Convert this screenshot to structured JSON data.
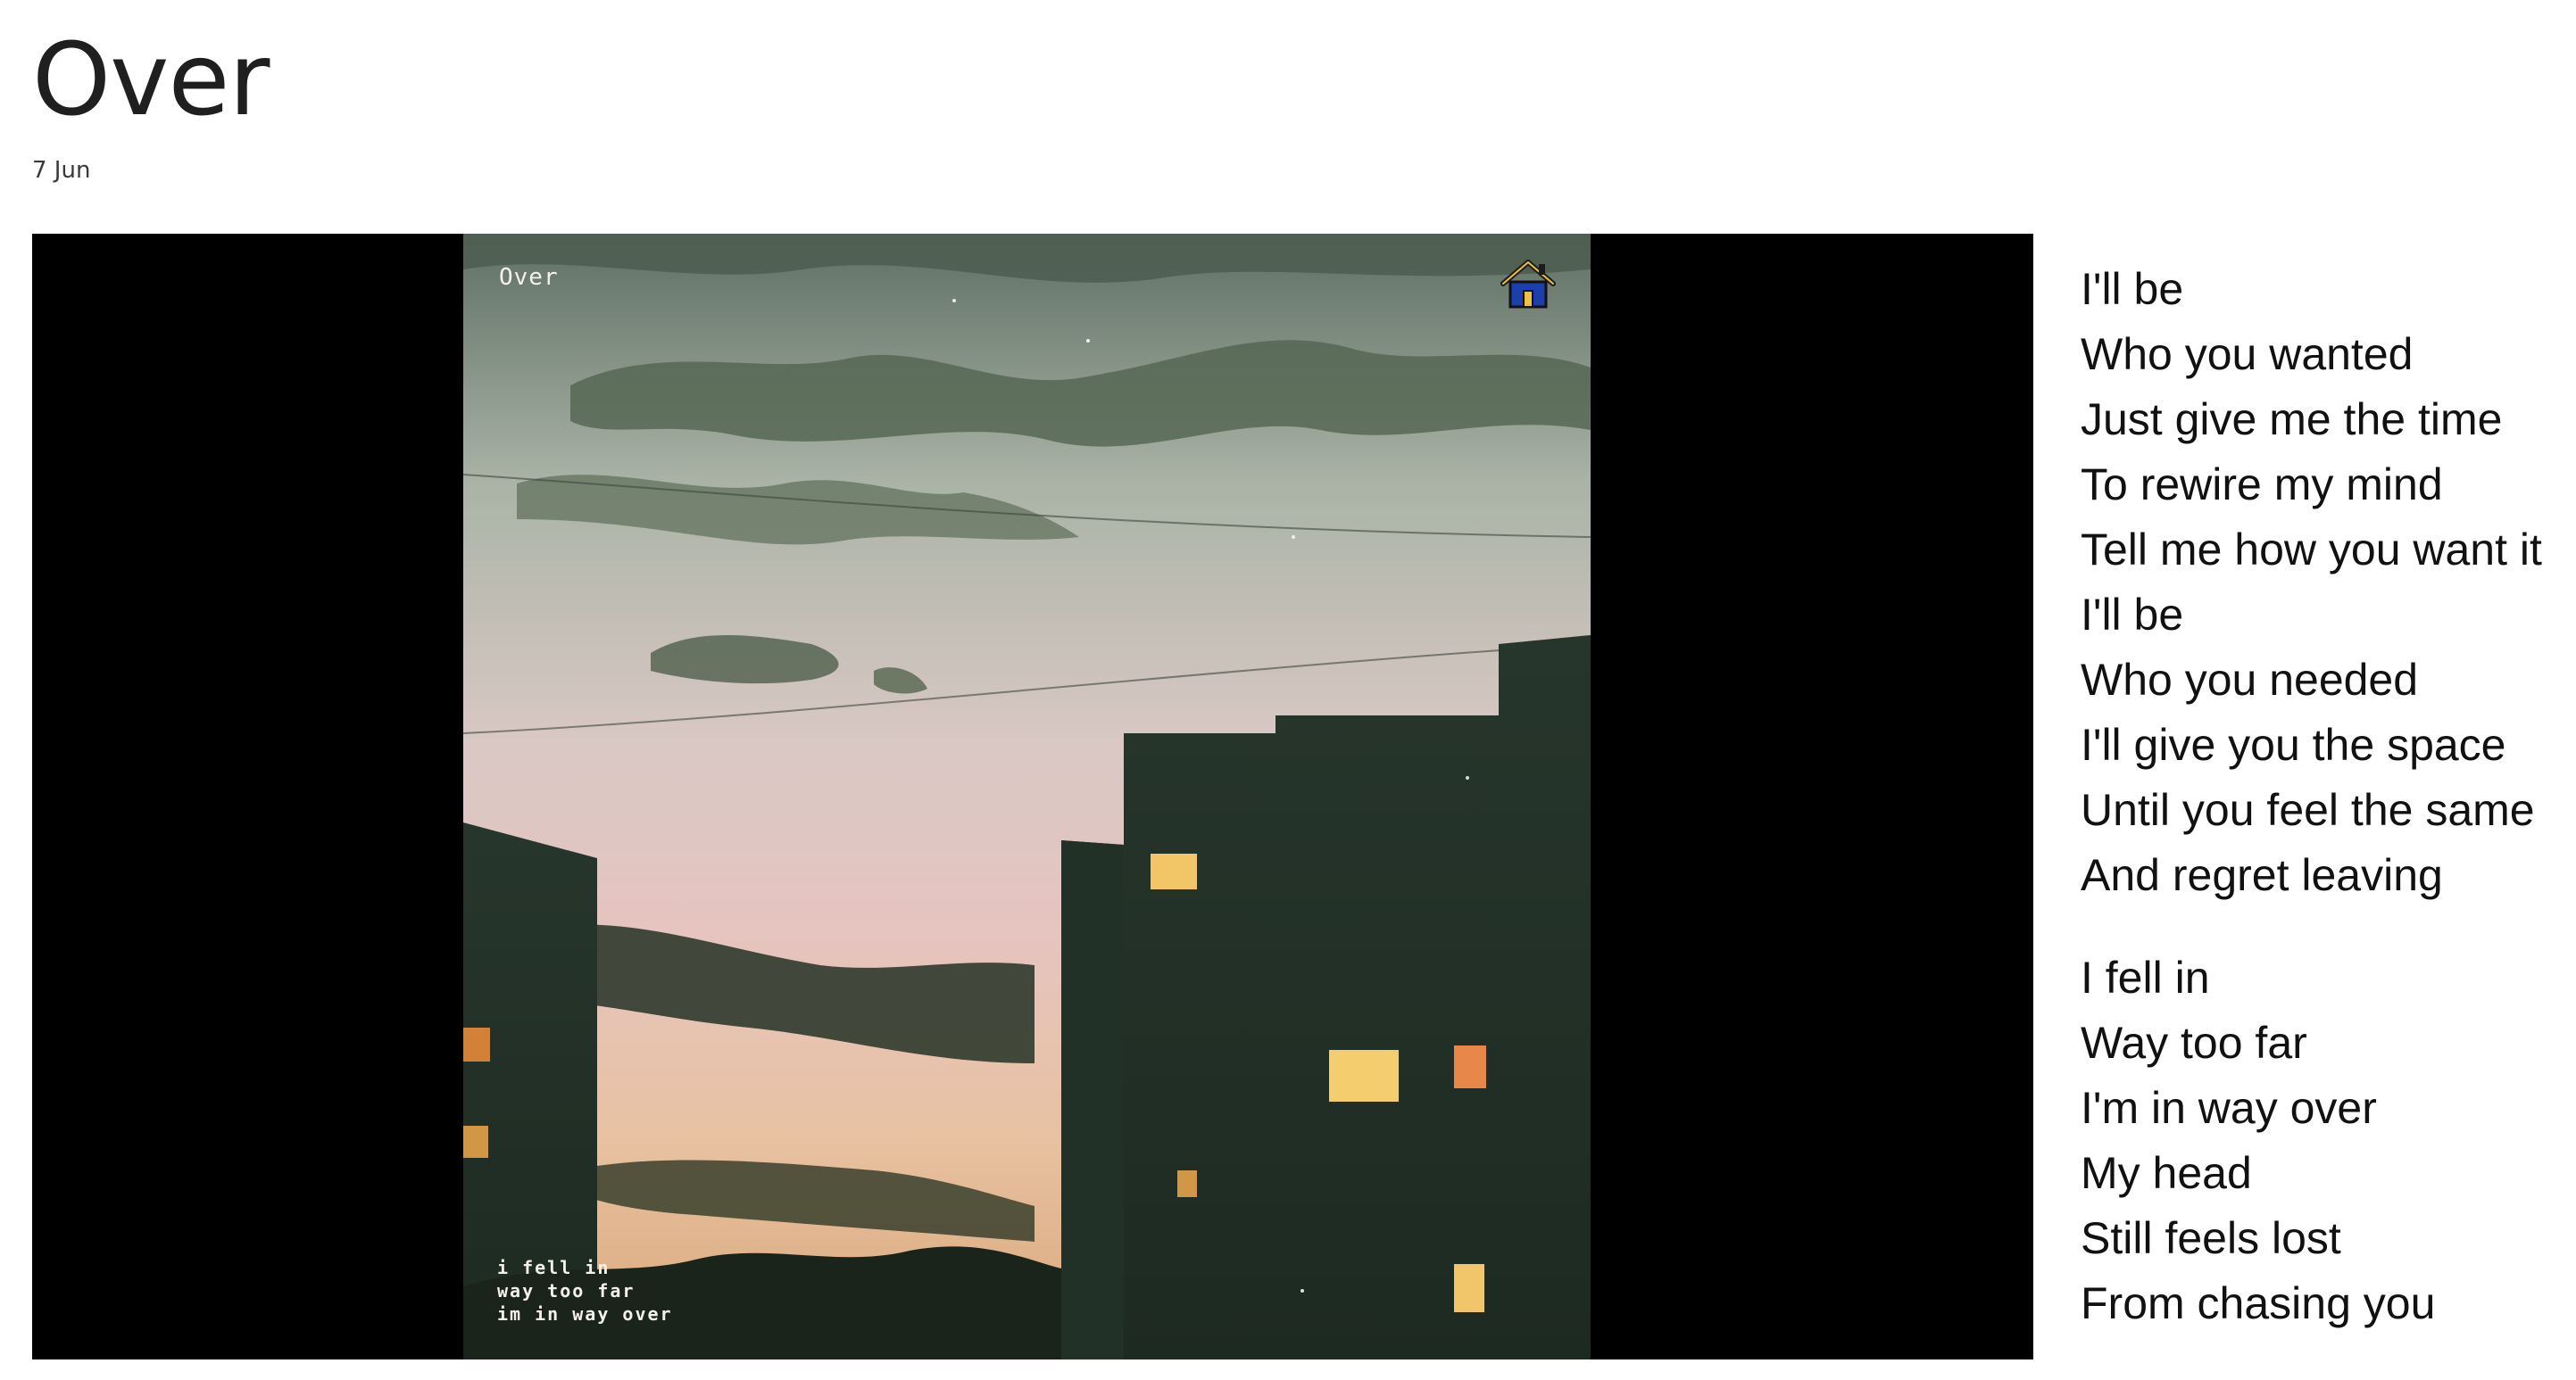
{
  "post": {
    "title": "Over",
    "date": "7 Jun"
  },
  "media": {
    "overlay_title": "Over",
    "overlay_icon": "house-icon",
    "caption_lines": [
      "i fell in",
      "way too far",
      "im in way over"
    ]
  },
  "lyrics": {
    "stanza1": [
      "I'll be",
      "Who you wanted",
      "Just give me the time",
      "To rewire my mind",
      "Tell me how you want it",
      "I'll be",
      "Who you needed",
      "I'll give you the space",
      "Until you feel the same",
      "And regret leaving"
    ],
    "stanza2": [
      "I fell in",
      "Way too far",
      "I'm in way over",
      "My head",
      "Still feels lost",
      "From chasing you"
    ]
  }
}
